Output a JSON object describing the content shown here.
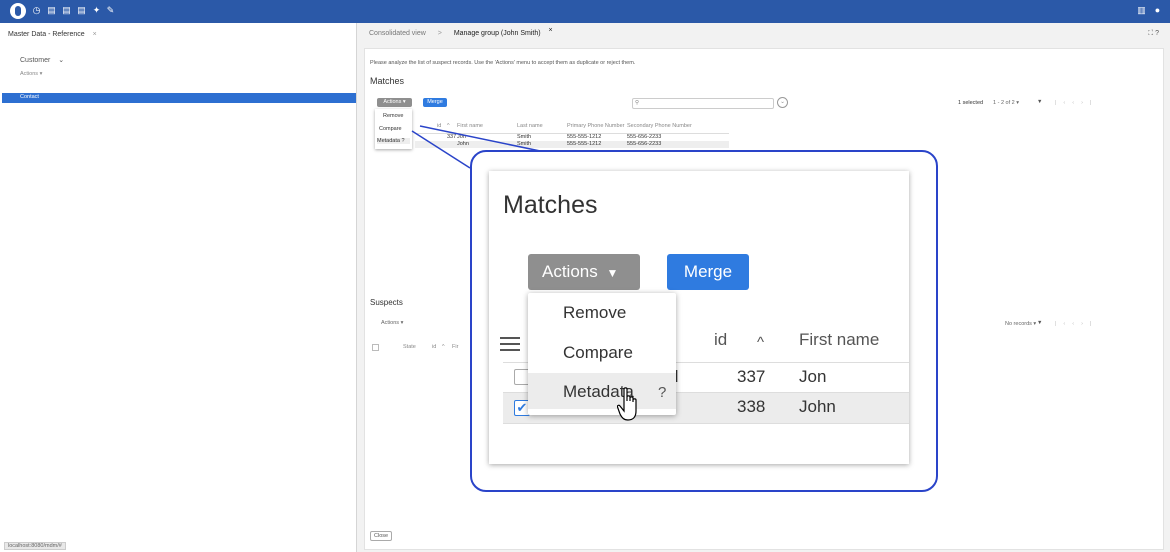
{
  "topbar": {
    "icons": [
      "clock-icon",
      "document-icon",
      "document-icon",
      "document-icon",
      "pin-icon",
      "pen-icon"
    ],
    "right_icons": [
      "panel-icon",
      "user-icon"
    ]
  },
  "left": {
    "title": "Master Data - Reference",
    "close": "×",
    "entity": "Customer",
    "entity_caret": "⌄",
    "actions": "Actions ▾",
    "nav_selected": "Contact",
    "statusbar": "localhost:8080/mdm/#"
  },
  "tabs": {
    "consolidated": "Consolidated view",
    "separator": ">",
    "manage": "Manage group (John Smith)",
    "close": "×",
    "right": "⛶  ?"
  },
  "main": {
    "instruction": "Please analyze the list of suspect records. Use the 'Actions' menu to accept them as duplicate or reject them.",
    "matches_title": "Matches",
    "actions_btn": "Actions ▾",
    "merge_btn": "Merge",
    "search_icon": "search-icon",
    "selected_info": "1 selected",
    "pager": "1 - 2 of 2 ▾",
    "menu": [
      "Remove",
      "Compare",
      "Metadata ?"
    ],
    "columns": [
      "id",
      "^",
      "First name",
      "Last name",
      "Primary Phone Number",
      "Secondary Phone Number"
    ],
    "rows": [
      {
        "id": "337",
        "first": "Jon",
        "last": "Smith",
        "primary": "555-555-1212",
        "secondary": "555-656-2233"
      },
      {
        "id": "338",
        "first": "John",
        "last": "Smith",
        "primary": "555-555-1212",
        "secondary": "555-656-2233"
      }
    ],
    "suspects_title": "Suspects",
    "suspects_actions": "Actions ▾",
    "suspects_columns": [
      "State",
      "id",
      "^",
      "Fir"
    ],
    "no_records": "No records ▾",
    "close_btn": "Close"
  },
  "zoom": {
    "title": "Matches",
    "actions_btn": "Actions",
    "merge_btn": "Merge",
    "menu": [
      "Remove",
      "Compare",
      "Metadata"
    ],
    "help": "?",
    "col_id": "id",
    "col_sort": "^",
    "col_first": "First name",
    "partial1": "d",
    "partial2": "n",
    "rows": [
      {
        "id": "337",
        "first": "Jon"
      },
      {
        "id": "338",
        "first": "John"
      }
    ]
  }
}
